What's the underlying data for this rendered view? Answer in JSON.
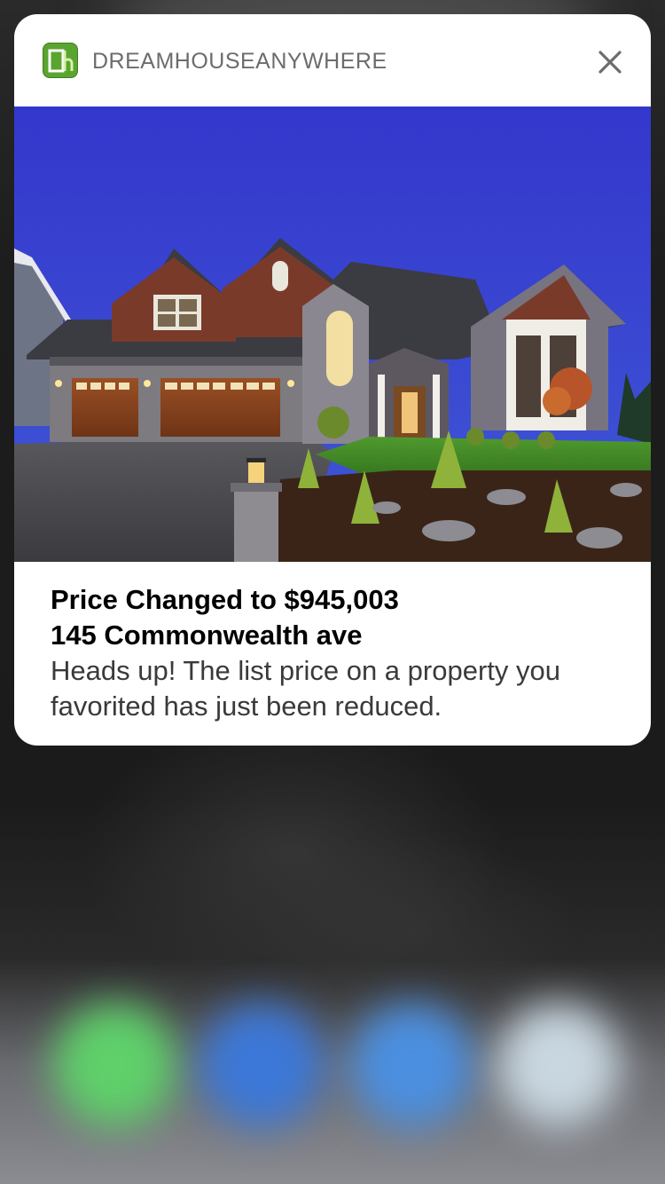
{
  "notification": {
    "app_name": "DREAMHOUSEANYWHERE",
    "app_icon": "dh-logo-icon",
    "title_line1": "Price Changed to $945,003",
    "title_line2": "145 Commonwealth ave",
    "body_line1": "Heads up! The list price on a property you",
    "body_line2": "favorited has just been reduced.",
    "close_icon": "close-icon",
    "image": "house-photo"
  },
  "colors": {
    "brand_green": "#5aa52f",
    "sky_blue": "#3a40c8",
    "card_background": "#ffffff"
  }
}
